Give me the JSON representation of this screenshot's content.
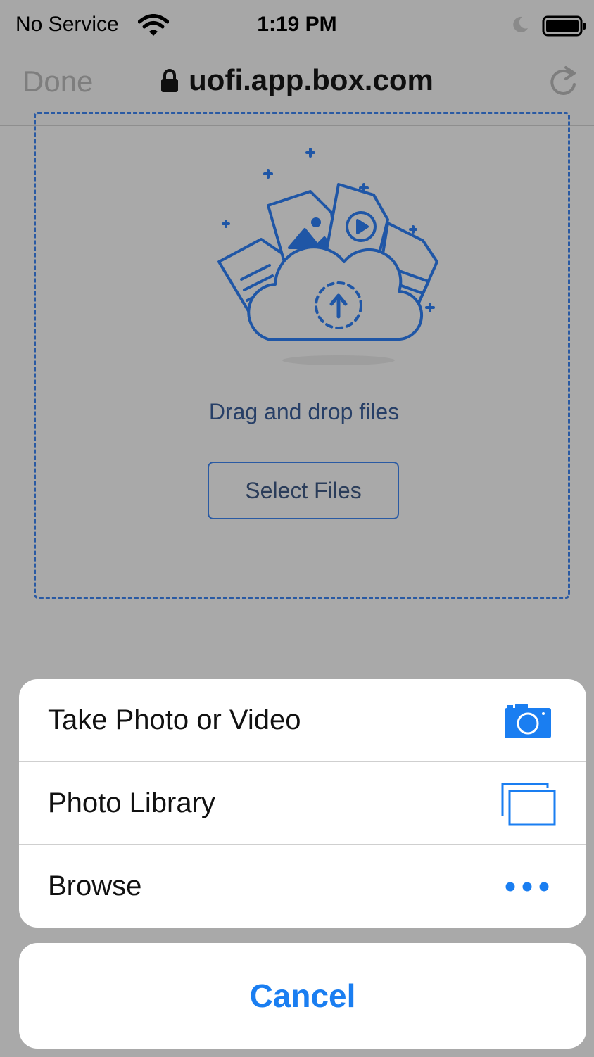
{
  "status_bar": {
    "carrier": "No Service",
    "time": "1:19 PM"
  },
  "nav_bar": {
    "done_label": "Done",
    "url": "uofi.app.box.com"
  },
  "upload": {
    "drag_text": "Drag and drop files",
    "select_button": "Select Files"
  },
  "action_sheet": {
    "items": [
      {
        "label": "Take Photo or Video",
        "icon": "camera-icon"
      },
      {
        "label": "Photo Library",
        "icon": "photo-library-icon"
      },
      {
        "label": "Browse",
        "icon": "more-dots-icon"
      }
    ],
    "cancel_label": "Cancel"
  },
  "colors": {
    "accent": "#1a7ef1",
    "upload_blue": "#2a5aa3",
    "dim_background": "#a9a9a9"
  }
}
